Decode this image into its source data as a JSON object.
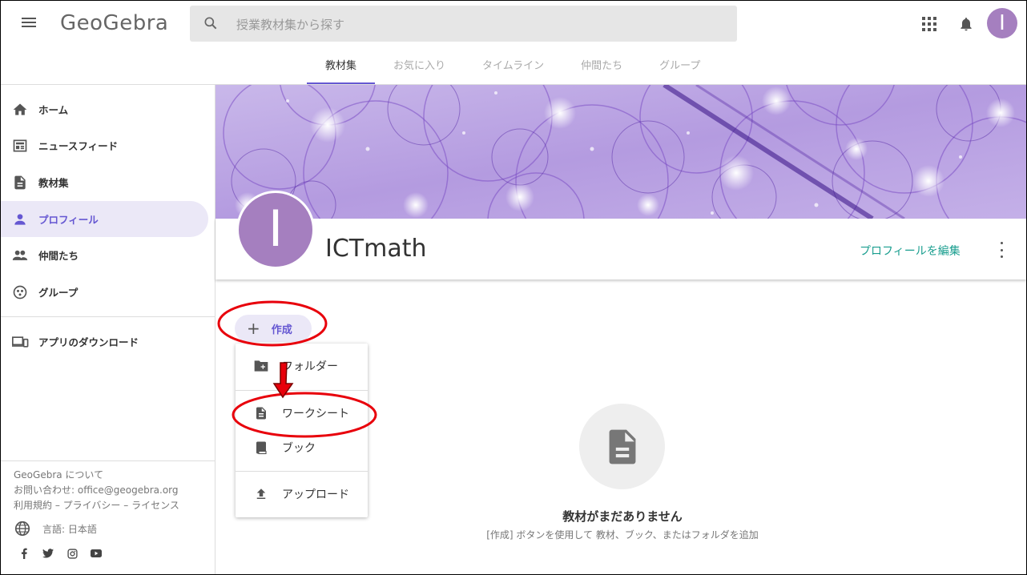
{
  "header": {
    "logo": "GeoGebra",
    "search_placeholder": "授業教材集から探す",
    "avatar_letter": "I",
    "tabs": [
      {
        "label": "教材集",
        "active": true
      },
      {
        "label": "お気に入り"
      },
      {
        "label": "タイムライン"
      },
      {
        "label": "仲間たち"
      },
      {
        "label": "グループ"
      }
    ]
  },
  "sidebar": {
    "items": [
      {
        "label": "ホーム",
        "icon": "home-icon"
      },
      {
        "label": "ニュースフィード",
        "icon": "newsfeed-icon"
      },
      {
        "label": "教材集",
        "icon": "document-icon"
      },
      {
        "label": "プロフィール",
        "icon": "person-icon",
        "active": true
      },
      {
        "label": "仲間たち",
        "icon": "people-icon"
      },
      {
        "label": "グループ",
        "icon": "group-icon"
      },
      {
        "label": "アプリのダウンロード",
        "icon": "devices-icon"
      }
    ],
    "footer": {
      "about": "GeoGebra について",
      "contact": "お問い合わせ: office@geogebra.org",
      "terms": "利用規約",
      "sep": "–",
      "privacy": "プライバシー",
      "license": "ライセンス",
      "language": "言語: 日本語"
    },
    "social": [
      "facebook-icon",
      "twitter-icon",
      "instagram-icon",
      "youtube-icon"
    ]
  },
  "profile": {
    "avatar_letter": "I",
    "username": "ICTmath",
    "edit_label": "プロフィールを編集"
  },
  "create": {
    "plus": "+",
    "label": "作成",
    "menu": [
      {
        "label": "フォルダー",
        "icon": "new-folder-icon"
      },
      {
        "label": "ワークシート",
        "icon": "worksheet-icon"
      },
      {
        "label": "ブック",
        "icon": "book-icon"
      },
      {
        "label": "アップロード",
        "icon": "upload-icon"
      }
    ]
  },
  "empty_state": {
    "title": "教材がまだありません",
    "subtitle": "[作成] ボタンを使用して 教材、ブック、またはフォルダを追加"
  },
  "colors": {
    "accent": "#6557d2",
    "teal": "#1a9e8f",
    "avatar": "#a57fbf",
    "annotation": "#e8000b"
  }
}
